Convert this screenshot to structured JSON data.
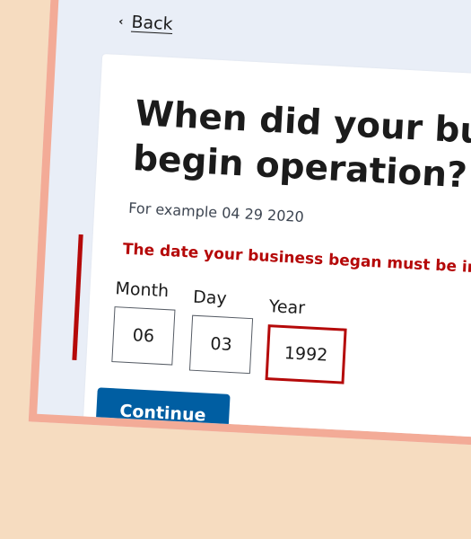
{
  "nav": {
    "back_label": "Back",
    "back_icon": "chevron-left-icon"
  },
  "form": {
    "heading": "When did your business begin operation?",
    "hint": "For example 04 29 2020",
    "error": "The date your business began must be in the past",
    "fields": {
      "month": {
        "label": "Month",
        "value": "06"
      },
      "day": {
        "label": "Day",
        "value": "03"
      },
      "year": {
        "label": "Year",
        "value": "1992"
      }
    },
    "continue_label": "Continue"
  },
  "colors": {
    "error": "#b50909",
    "primary": "#005ea2",
    "background": "#f6dcc0",
    "frame": "#f3ab97",
    "page": "#e9eef7"
  }
}
